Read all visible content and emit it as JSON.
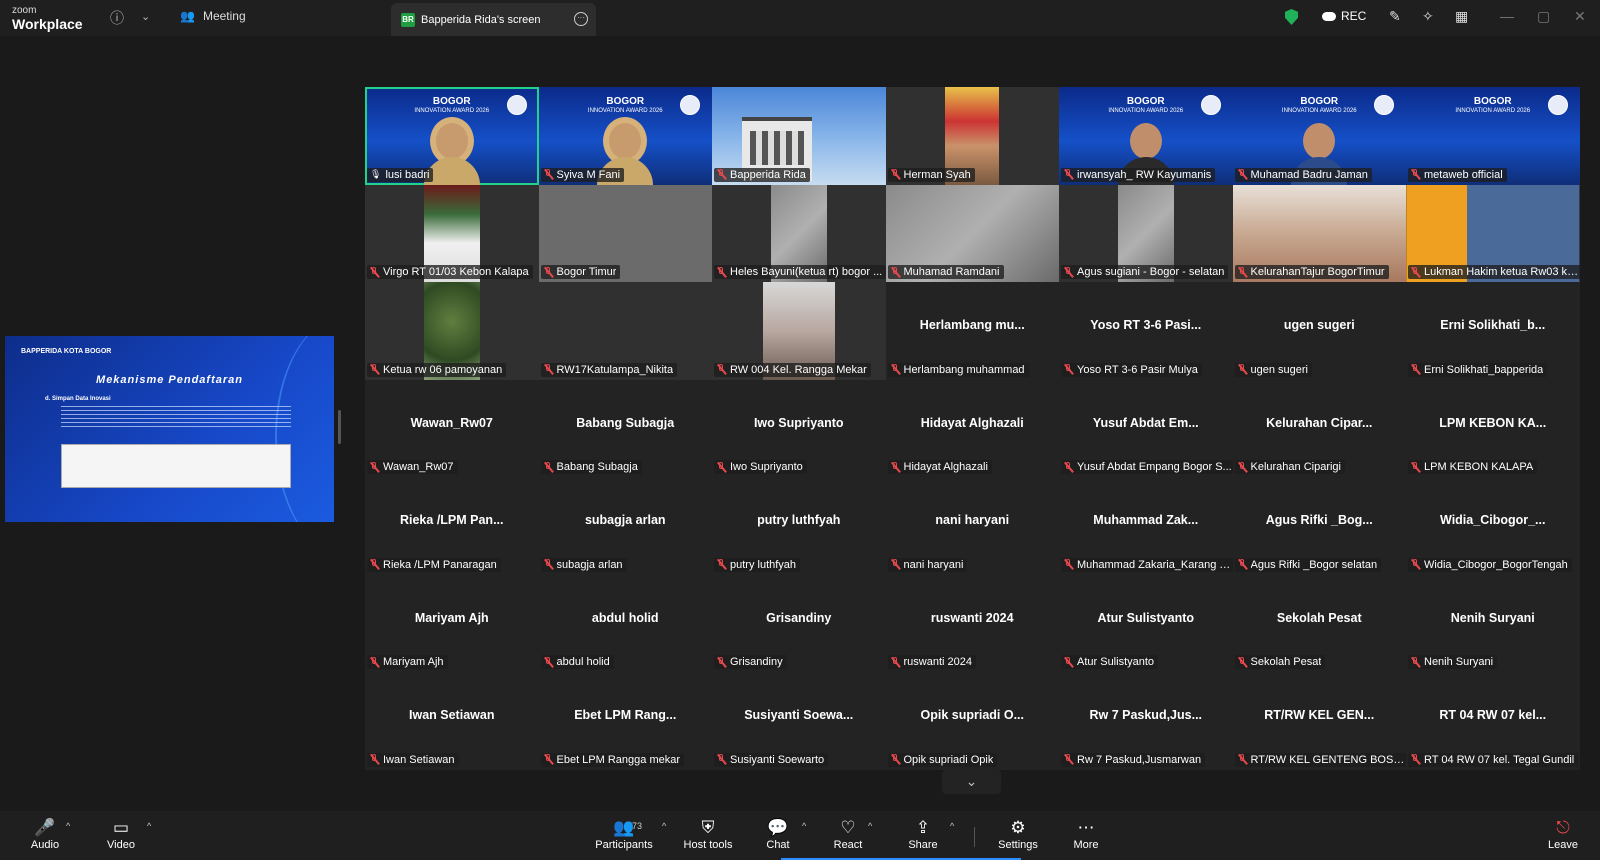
{
  "app": {
    "logo_top": "zoom",
    "logo_bottom": "Workplace"
  },
  "topbar": {
    "info_icon": "info-icon",
    "meeting_label": "Meeting",
    "share_tab_badge": "BR",
    "share_tab_label": "Bapperida Rida's screen",
    "rec_label": "REC"
  },
  "shared_screen": {
    "header": "BAPPERIDA KOTA BOGOR",
    "title": "Mekanisme Pendaftaran",
    "subtitle": "d. Simpan Data Inovasi"
  },
  "tiles": [
    {
      "type": "banner",
      "label": "lusi badri",
      "banner_title": "BOGOR",
      "banner_sub": "INNOVATION AWARD 2026",
      "person": "hijab",
      "active": true,
      "muted": false
    },
    {
      "type": "banner",
      "label": "Syiva M Fani",
      "banner_title": "BOGOR",
      "banner_sub": "INNOVATION AWARD 2026",
      "person": "hijab",
      "muted": true
    },
    {
      "type": "building",
      "label": "Bapperida Rida",
      "muted": true
    },
    {
      "type": "video",
      "label": "Herman Syah",
      "frame": "herman",
      "muted": true
    },
    {
      "type": "banner",
      "label": "irwansyah_ RW Kayumanis",
      "banner_title": "BOGOR",
      "banner_sub": "INNOVATION AWARD 2026",
      "person": "dark",
      "muted": true
    },
    {
      "type": "banner",
      "label": "Muhamad Badru Jaman",
      "banner_title": "BOGOR",
      "banner_sub": "INNOVATION AWARD 2026",
      "person": "blue",
      "muted": true
    },
    {
      "type": "banner",
      "label": "metaweb official",
      "banner_title": "BOGOR",
      "banner_sub": "INNOVATION AWARD 2026",
      "muted": true
    },
    {
      "type": "video",
      "label": "Virgo  RT 01/03 Kebon Kalapa",
      "frame": "redwall",
      "muted": true
    },
    {
      "type": "video",
      "label": "Bogor Timur",
      "frame": "gray",
      "muted": true
    },
    {
      "type": "video",
      "label": "Heles Bayuni(ketua rt) bogor ...",
      "frame": "blur",
      "muted": true
    },
    {
      "type": "video",
      "label": "Muhamad Ramdani",
      "frame": "blur-wide",
      "muted": true
    },
    {
      "type": "video",
      "label": "Agus sugiani - Bogor - selatan",
      "frame": "blur",
      "muted": true
    },
    {
      "type": "video",
      "label": "KelurahanTajur BogorTimur",
      "frame": "meeting",
      "muted": true
    },
    {
      "type": "video",
      "label": "Lukman Hakim ketua Rw03 kel...",
      "frame": "orange",
      "muted": true
    },
    {
      "type": "video",
      "label": "Ketua rw 06 pamoyanan",
      "frame": "tree",
      "muted": true
    },
    {
      "type": "empty",
      "label": "RW17Katulampa_Nikita",
      "muted": true
    },
    {
      "type": "video",
      "label": "RW 004 Kel. Rangga Mekar",
      "frame": "rw004",
      "muted": true
    },
    {
      "type": "name",
      "name": "Herlambang  mu...",
      "label": "Herlambang muhammad",
      "muted": true
    },
    {
      "type": "name",
      "name": "Yoso RT 3-6 Pasi...",
      "label": "Yoso RT 3-6 Pasir Mulya",
      "muted": true
    },
    {
      "type": "name",
      "name": "ugen sugeri",
      "label": "ugen sugeri",
      "muted": true
    },
    {
      "type": "name",
      "name": "Erni  Solikhati_b...",
      "label": "Erni Solikhati_bapperida",
      "muted": true
    },
    {
      "type": "name",
      "name": "Wawan_Rw07",
      "label": "Wawan_Rw07",
      "muted": true
    },
    {
      "type": "name",
      "name": "Babang Subagja",
      "label": "Babang Subagja",
      "muted": true
    },
    {
      "type": "name",
      "name": "Iwo Supriyanto",
      "label": "Iwo Supriyanto",
      "muted": true
    },
    {
      "type": "name",
      "name": "Hidayat Alghazali",
      "label": "Hidayat Alghazali",
      "muted": true
    },
    {
      "type": "name",
      "name": "Yusuf Abdat Em...",
      "label": "Yusuf Abdat Empang Bogor S...",
      "muted": true
    },
    {
      "type": "name",
      "name": "Kelurahan  Cipar...",
      "label": "Kelurahan Ciparigi",
      "muted": true
    },
    {
      "type": "name",
      "name": "LPM KEBON KA...",
      "label": "LPM KEBON KALAPA",
      "muted": true
    },
    {
      "type": "name",
      "name": "Rieka /LPM Pan...",
      "label": "Rieka /LPM Panaragan",
      "muted": true
    },
    {
      "type": "name",
      "name": "subagja arlan",
      "label": "subagja arlan",
      "muted": true
    },
    {
      "type": "name",
      "name": "putry luthfyah",
      "label": "putry luthfyah",
      "muted": true
    },
    {
      "type": "name",
      "name": "nani haryani",
      "label": "nani haryani",
      "muted": true
    },
    {
      "type": "name",
      "name": "Muhammad  Zak...",
      "label": "Muhammad Zakaria_Karang T...",
      "muted": true
    },
    {
      "type": "name",
      "name": "Agus Rifki _Bog...",
      "label": "Agus Rifki _Bogor selatan",
      "muted": true
    },
    {
      "type": "name",
      "name": "Widia_Cibogor_...",
      "label": "Widia_Cibogor_BogorTengah",
      "muted": true
    },
    {
      "type": "name",
      "name": "Mariyam Ajh",
      "label": "Mariyam Ajh",
      "muted": true
    },
    {
      "type": "name",
      "name": "abdul holid",
      "label": "abdul holid",
      "muted": true
    },
    {
      "type": "name",
      "name": "Grisandiny",
      "label": "Grisandiny",
      "muted": true
    },
    {
      "type": "name",
      "name": "ruswanti 2024",
      "label": "ruswanti 2024",
      "muted": true
    },
    {
      "type": "name",
      "name": "Atur Sulistyanto",
      "label": "Atur Sulistyanto",
      "muted": true
    },
    {
      "type": "name",
      "name": "Sekolah Pesat",
      "label": "Sekolah Pesat",
      "muted": true
    },
    {
      "type": "name",
      "name": "Nenih Suryani",
      "label": "Nenih Suryani",
      "muted": true
    },
    {
      "type": "name",
      "name": "Iwan Setiawan",
      "label": "Iwan Setiawan",
      "muted": true
    },
    {
      "type": "name",
      "name": "Ebet  LPM  Rang...",
      "label": "Ebet LPM Rangga mekar",
      "muted": true
    },
    {
      "type": "name",
      "name": "Susiyanti  Soewa...",
      "label": "Susiyanti Soewarto",
      "muted": true
    },
    {
      "type": "name",
      "name": "Opik  supriadi  O...",
      "label": "Opik supriadi Opik",
      "muted": true
    },
    {
      "type": "name",
      "name": "Rw 7 Paskud,Jus...",
      "label": "Rw 7 Paskud,Jusmarwan",
      "muted": true
    },
    {
      "type": "name",
      "name": "RT/RW KEL GEN...",
      "label": "RT/RW KEL GENTENG BOSEL",
      "muted": true
    },
    {
      "type": "name",
      "name": "RT 04 RW 07 kel...",
      "label": "RT 04 RW 07 kel. Tegal Gundil",
      "muted": true
    }
  ],
  "toolbar": {
    "audio": "Audio",
    "video": "Video",
    "participants": "Participants",
    "participants_count": "73",
    "host_tools": "Host tools",
    "chat": "Chat",
    "react": "React",
    "share": "Share",
    "settings": "Settings",
    "more": "More",
    "leave": "Leave"
  }
}
